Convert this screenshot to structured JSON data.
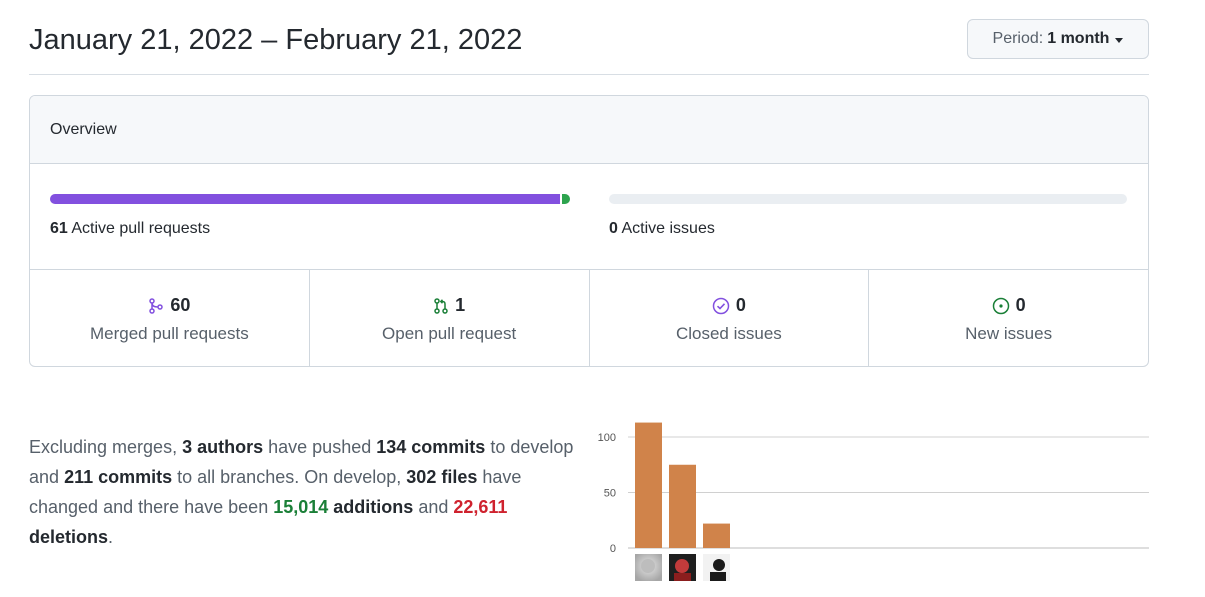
{
  "header": {
    "date_range": "January 21, 2022 – February 21, 2022",
    "period_label": "Period:",
    "period_value": "1 month"
  },
  "overview": {
    "title": "Overview",
    "active_pull_requests": {
      "count": "61",
      "label": "Active pull requests"
    },
    "active_issues": {
      "count": "0",
      "label": "Active issues"
    },
    "pr_progress": {
      "merged_fraction": 0.984,
      "open_fraction": 0.016
    },
    "stats": [
      {
        "icon": "merged-pr-icon",
        "count": "60",
        "label": "Merged pull requests",
        "color": "#8250df"
      },
      {
        "icon": "open-pr-icon",
        "count": "1",
        "label": "Open pull request",
        "color": "#1a7f37"
      },
      {
        "icon": "closed-issue-icon",
        "count": "0",
        "label": "Closed issues",
        "color": "#8250df"
      },
      {
        "icon": "new-issue-icon",
        "count": "0",
        "label": "New issues",
        "color": "#1a7f37"
      }
    ]
  },
  "summary": {
    "p1": "Excluding merges,",
    "authors": "3 authors",
    "p2": "have pushed",
    "commits_default": "134 commits",
    "p3": "to develop and",
    "commits_all": "211 commits",
    "p4": "to all branches. On develop,",
    "files": "302 files",
    "p5": "have changed and there have been",
    "additions_count": "15,014",
    "additions_word": "additions",
    "p6": "and",
    "deletions_count": "22,611",
    "deletions_word": "deletions",
    "p7": "."
  },
  "chart_data": {
    "type": "bar",
    "categories": [
      "author-1",
      "author-2",
      "author-3"
    ],
    "values": [
      113,
      75,
      22
    ],
    "ylim": [
      0,
      100
    ],
    "yticks": [
      0,
      50,
      100
    ],
    "grid": true,
    "bar_color": "#d0834a"
  }
}
